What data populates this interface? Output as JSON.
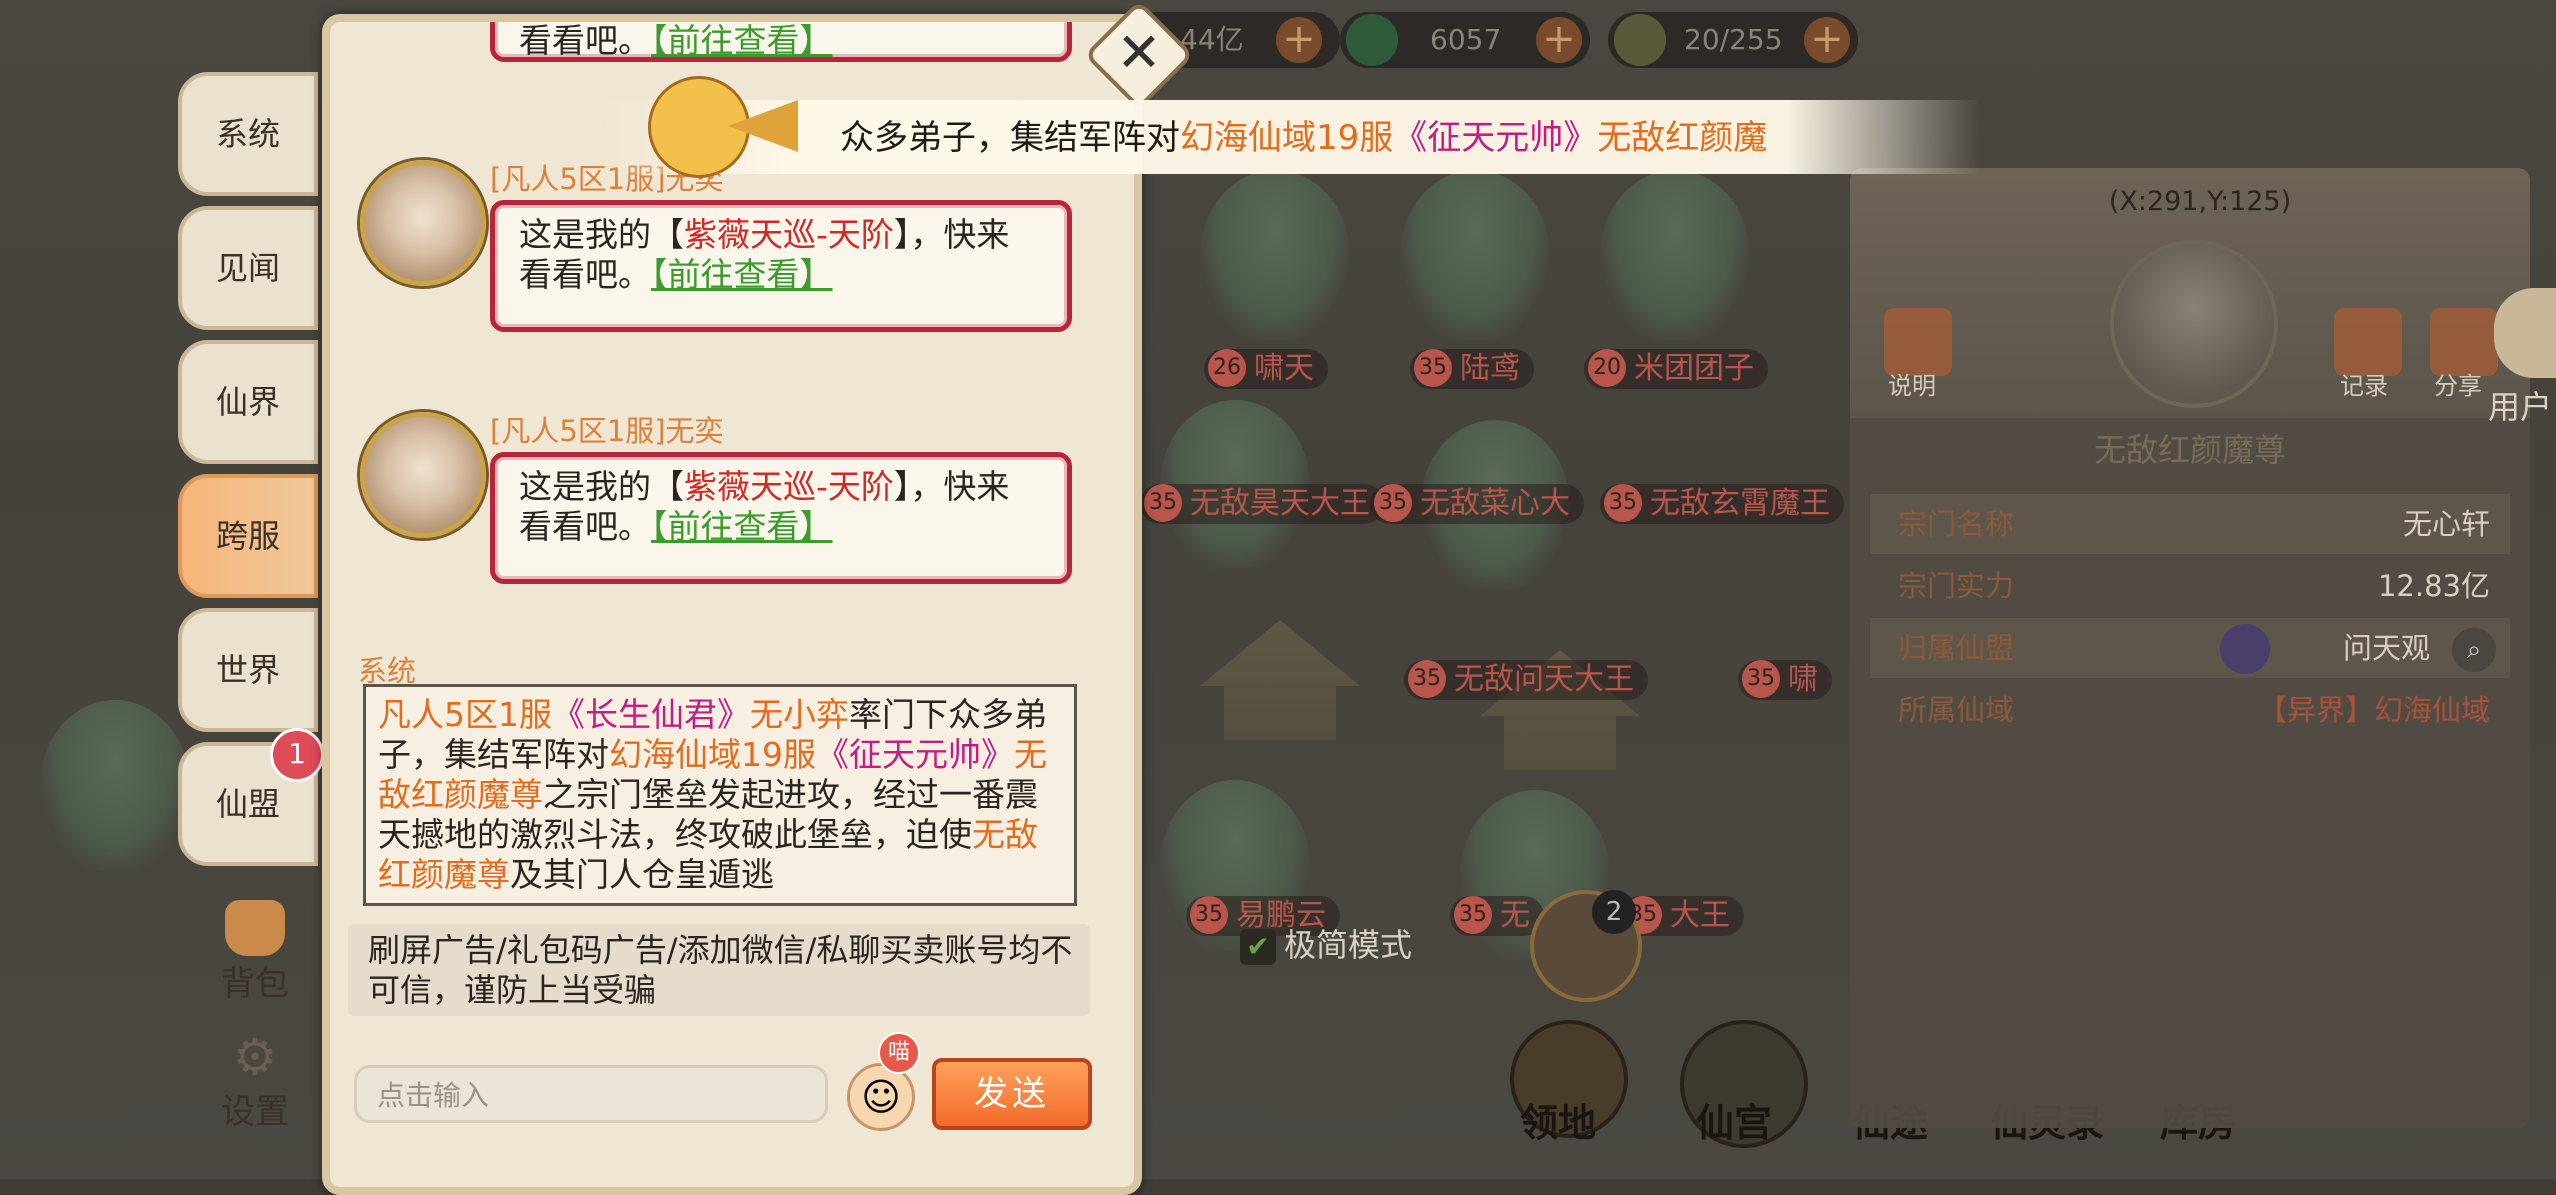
{
  "resources": [
    {
      "value": "44亿"
    },
    {
      "value": "6057"
    },
    {
      "value": "20/255"
    }
  ],
  "side_tabs": [
    {
      "label": "系统"
    },
    {
      "label": "见闻"
    },
    {
      "label": "仙界"
    },
    {
      "label": "跨服",
      "active": true
    },
    {
      "label": "世界"
    },
    {
      "label": "仙盟",
      "badge": "1"
    }
  ],
  "side_buttons": {
    "bag": "背包",
    "settings": "设置"
  },
  "chat": {
    "partial_top": {
      "text": "看看吧。",
      "link": "【前往查看】"
    },
    "messages": [
      {
        "sender": "[凡人5区1服]无奕",
        "prefix": "这是我的【",
        "item": "紫薇天巡-天阶",
        "suffix": "】，快来",
        "line2": "看看吧。",
        "link": "【前往查看】"
      },
      {
        "sender": "[凡人5区1服]无奕",
        "prefix": "这是我的【",
        "item": "紫薇天巡-天阶",
        "suffix": "】，快来",
        "line2": "看看吧。",
        "link": "【前往查看】"
      }
    ],
    "system_label": "系统",
    "system_message": {
      "attacker_server": "凡人5区1服",
      "attacker_title": "《长生仙君》",
      "attacker_name": "无小弈",
      "t1": "率门下众多弟子，集结军阵对",
      "target_server": "幻海仙域19服",
      "target_title": "《征天元帅》",
      "target_name": "无敌红颜魔尊",
      "t2": "之宗门堡垒发起进攻，经过一番震天撼地的激烈斗法，终攻破此堡垒，迫使",
      "target_name2": "无敌红颜魔尊",
      "t3": "及其门人仓皇遁逃"
    },
    "warning": "刷屏广告/礼包码广告/添加微信/私聊买卖账号均不可信，谨防上当受骗",
    "input_placeholder": "点击输入",
    "emoji_badge": "喵",
    "send_label": "发送"
  },
  "marquee": {
    "t1": "众多弟子，集结军阵对",
    "server": "幻海仙域19服",
    "title": "《征天元帅》",
    "name": "无敌红颜魔"
  },
  "map": {
    "labels": [
      {
        "level": "26",
        "name": "啸天"
      },
      {
        "level": "35",
        "name": "陆鸢"
      },
      {
        "level": "20",
        "name": "米团团子"
      },
      {
        "level": "35",
        "name": "无敌昊天大王"
      },
      {
        "level": "35",
        "name": "无敌菜心大"
      },
      {
        "level": "35",
        "name": "无敌玄霄魔王"
      },
      {
        "level": "35",
        "name": "无敌问天大王"
      },
      {
        "level": "35",
        "name": "啸"
      },
      {
        "level": "35",
        "name": "易鹏云"
      },
      {
        "level": "35",
        "name": "无"
      },
      {
        "level": "35",
        "name": "大王"
      }
    ],
    "simple_mode": "极简模式",
    "group_badge": "2",
    "nav": [
      "领地",
      "仙宫",
      "仙途",
      "仙灵录",
      "库房"
    ]
  },
  "info_panel": {
    "coords": "(X:291,Y:125)",
    "buttons": [
      "说明",
      "记录",
      "分享"
    ],
    "user_button": "用户",
    "name": "无敌红颜魔尊",
    "rows": [
      {
        "label": "宗门名称",
        "value": "无心轩"
      },
      {
        "label": "宗门实力",
        "value": "12.83亿"
      },
      {
        "label": "归属仙盟",
        "value": "问天观"
      },
      {
        "label": "所属仙域",
        "value": "【异界】幻海仙域"
      }
    ]
  }
}
